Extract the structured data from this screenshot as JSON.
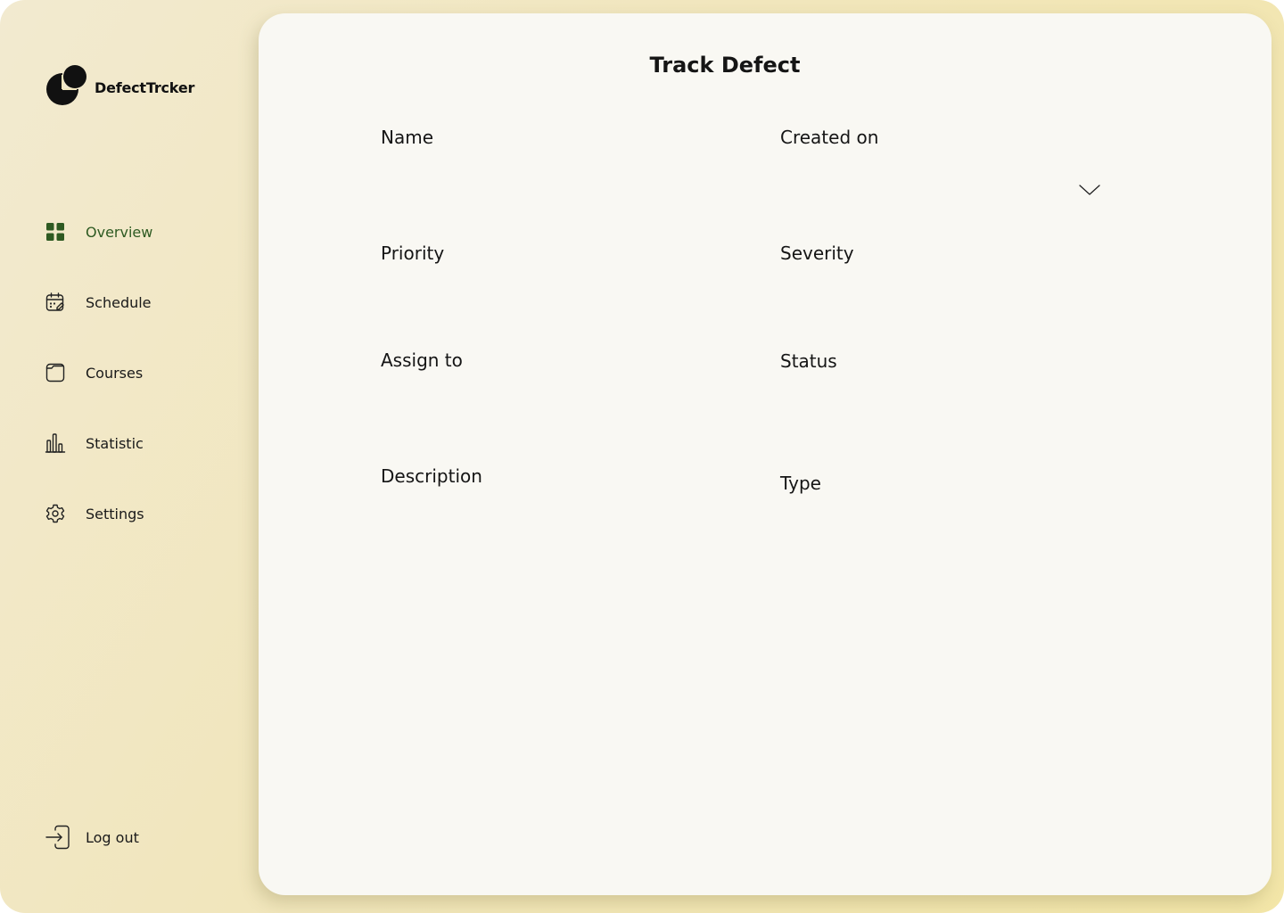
{
  "app": {
    "name": "DefectTrcker"
  },
  "sidebar": {
    "items": [
      {
        "label": "Overview",
        "icon": "grid-icon",
        "active": true
      },
      {
        "label": "Schedule",
        "icon": "calendar-edit-icon",
        "active": false
      },
      {
        "label": "Courses",
        "icon": "folder-icon",
        "active": false
      },
      {
        "label": "Statistic",
        "icon": "bar-chart-icon",
        "active": false
      },
      {
        "label": "Settings",
        "icon": "gear-icon",
        "active": false
      }
    ],
    "logout_label": "Log out",
    "logout_icon": "login-arrow-icon"
  },
  "form": {
    "title": "Track Defect",
    "fields": {
      "name": "Name",
      "created_on": "Created on",
      "priority": "Priority",
      "severity": "Severity",
      "assign_to": "Assign to",
      "status": "Status",
      "description": "Description",
      "type": "Type"
    },
    "created_on_dropdown_icon": "chevron-down-icon"
  },
  "colors": {
    "active_nav": "#2e5a22",
    "card_background": "#f9f8f3",
    "sidebar_gradient_start": "#f2ead0",
    "sidebar_gradient_end": "#f3e6a8",
    "text_primary": "#151515"
  }
}
